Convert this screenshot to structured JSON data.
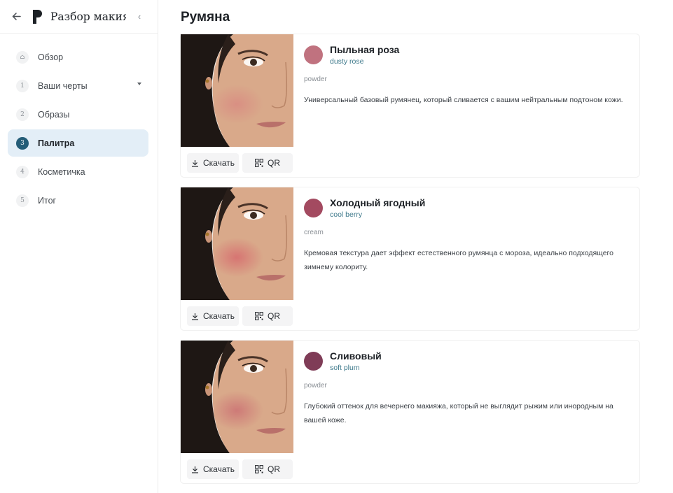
{
  "sidebar": {
    "title": "Разбор макия...",
    "back_icon": "arrow-left-icon",
    "collapse_icon": "chevron-left-icon",
    "items": [
      {
        "num": "⌂",
        "label": "Обзор",
        "active": false
      },
      {
        "num": "1",
        "label": "Ваши черты",
        "active": false,
        "has_caret": true
      },
      {
        "num": "2",
        "label": "Образы",
        "active": false
      },
      {
        "num": "3",
        "label": "Палитра",
        "active": true
      },
      {
        "num": "4",
        "label": "Косметичка",
        "active": false
      },
      {
        "num": "5",
        "label": "Итог",
        "active": false
      }
    ]
  },
  "main": {
    "title": "Румяна",
    "cards": [
      {
        "name": "Пыльная роза",
        "name_en": "dusty rose",
        "texture": "powder",
        "description": "Универсальный базовый румянец, который сливается с вашим нейтральным подтоном кожи.",
        "swatch_color": "#c0727f",
        "download_label": "Скачать",
        "qr_label": "QR"
      },
      {
        "name": "Холодный ягодный",
        "name_en": "cool berry",
        "texture": "cream",
        "description": "Кремовая текстура дает эффект естественного румянца с мороза, идеально подходящего зимнему колориту.",
        "swatch_color": "#a34a60",
        "download_label": "Скачать",
        "qr_label": "QR"
      },
      {
        "name": "Сливовый",
        "name_en": "soft plum",
        "texture": "powder",
        "description": "Глубокий оттенок для вечернего макияжа, который не выглядит рыжим или инородным на вашей коже.",
        "swatch_color": "#7f3c57",
        "download_label": "Скачать",
        "qr_label": "QR"
      }
    ]
  },
  "colors": {
    "accent": "#245d78",
    "active_bg": "#e3eef7",
    "subtitle": "#3f7a8c"
  }
}
